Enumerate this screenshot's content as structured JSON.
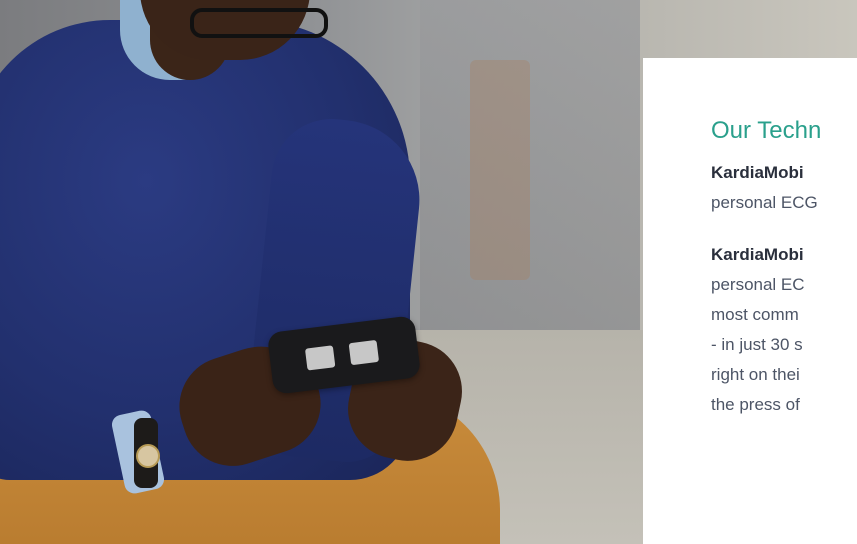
{
  "section": {
    "title": "Our Techn",
    "paragraphs": [
      {
        "brand": "KardiaMobi",
        "lines": [
          "personal ECG"
        ]
      },
      {
        "brand": "KardiaMobi",
        "lines": [
          "personal EC",
          "most comm",
          "- in just 30 s",
          "right on thei",
          "the press of"
        ]
      }
    ]
  },
  "photo": {
    "subject": "man-holding-phone-with-kardiamobile"
  },
  "colors": {
    "title": "#2aa08c",
    "body": "#4d5566",
    "brand": "#2a2f3c"
  }
}
